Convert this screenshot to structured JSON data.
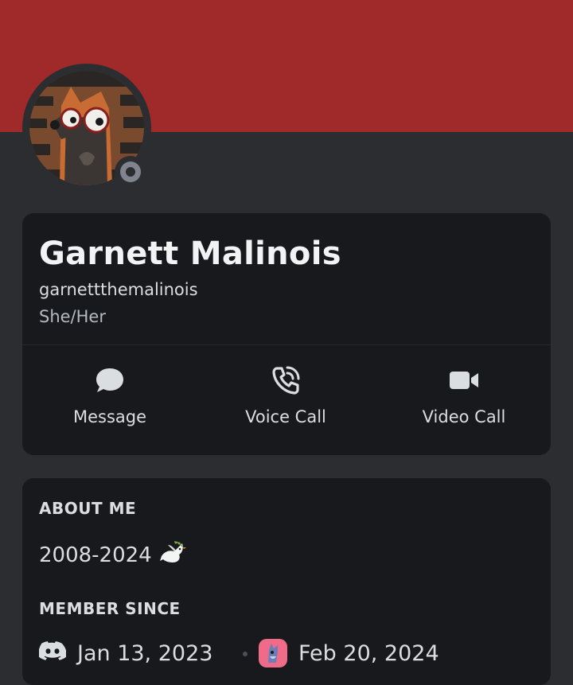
{
  "profile": {
    "display_name": "Garnett Malinois",
    "username": "garnettthemalinois",
    "pronouns": "She/Her",
    "status": "offline",
    "banner_color": "#a0292a"
  },
  "actions": {
    "message": {
      "label": "Message",
      "icon": "chat-bubble-icon"
    },
    "voice_call": {
      "label": "Voice Call",
      "icon": "phone-icon"
    },
    "video_call": {
      "label": "Video Call",
      "icon": "video-camera-icon"
    }
  },
  "about": {
    "title": "ABOUT ME",
    "text": "2008-2024",
    "emoji": "dove-icon"
  },
  "member_since": {
    "title": "MEMBER SINCE",
    "discord_date": "Jan 13, 2023",
    "server_date": "Feb 20, 2024"
  }
}
